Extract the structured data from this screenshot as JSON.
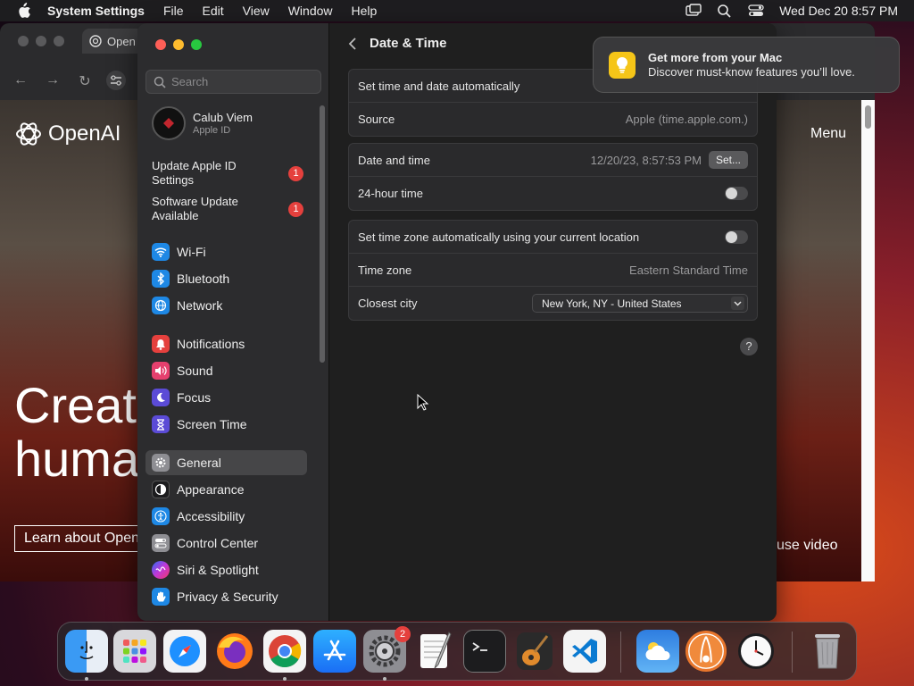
{
  "menubar": {
    "app_name": "System Settings",
    "menus": [
      "File",
      "Edit",
      "View",
      "Window",
      "Help"
    ],
    "clock": "Wed Dec 20  8:57 PM"
  },
  "browser": {
    "tab_title": "Open",
    "logo_text": "OpenAI",
    "hero_line1": "Creati",
    "hero_line2": "huma",
    "cta": "Learn about Open",
    "menu_link": "Menu",
    "video_link": "use video"
  },
  "sidebar": {
    "search_placeholder": "Search",
    "user": {
      "name": "Calub Viem",
      "subtitle": "Apple ID"
    },
    "alerts": [
      {
        "label": "Update Apple ID Settings",
        "badge": "1"
      },
      {
        "label": "Software Update Available",
        "badge": "1"
      }
    ],
    "items": [
      {
        "label": "Wi-Fi",
        "color": "#1e88e5"
      },
      {
        "label": "Bluetooth",
        "color": "#1e88e5"
      },
      {
        "label": "Network",
        "color": "#1e88e5"
      },
      {
        "label": "Notifications",
        "color": "#e5403d"
      },
      {
        "label": "Sound",
        "color": "#e5406e"
      },
      {
        "label": "Focus",
        "color": "#5b4bd6"
      },
      {
        "label": "Screen Time",
        "color": "#5b4bd6"
      },
      {
        "label": "General",
        "color": "#8e8e93"
      },
      {
        "label": "Appearance",
        "color": "#1c1c1e"
      },
      {
        "label": "Accessibility",
        "color": "#1e88e5"
      },
      {
        "label": "Control Center",
        "color": "#8e8e93"
      },
      {
        "label": "Siri & Spotlight",
        "color": "#b14ad8"
      },
      {
        "label": "Privacy & Security",
        "color": "#1e88e5"
      }
    ]
  },
  "main": {
    "title": "Date & Time",
    "group1": {
      "auto_label": "Set time and date automatically",
      "source_label": "Source",
      "source_value": "Apple (time.apple.com.)"
    },
    "group2": {
      "datetime_label": "Date and time",
      "datetime_value": "12/20/23, 8:57:53 PM",
      "set_button": "Set...",
      "hour24_label": "24-hour time"
    },
    "group3": {
      "auto_tz_label": "Set time zone automatically using your current location",
      "tz_label": "Time zone",
      "tz_value": "Eastern Standard Time",
      "city_label": "Closest city",
      "city_value": "New York, NY - United States"
    },
    "help": "?"
  },
  "notification": {
    "title": "Get more from your Mac",
    "body": "Discover must-know features you’ll love."
  },
  "dock": {
    "settings_badge": "2"
  }
}
